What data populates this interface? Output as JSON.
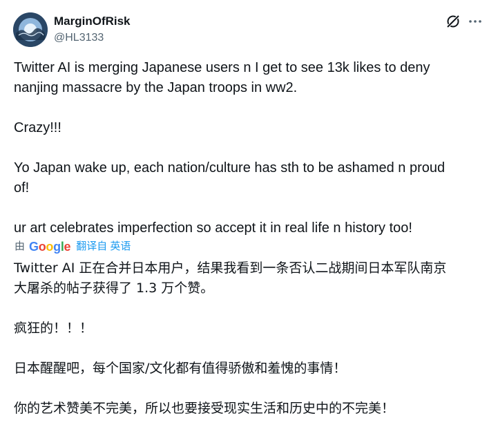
{
  "author": {
    "display_name": "MarginOfRisk",
    "handle": "@HL3133"
  },
  "icons": {
    "grok": "grok-icon",
    "more": "more-icon",
    "avatar": "avatar"
  },
  "tweet": {
    "original_text": "Twitter AI is merging Japanese users n I get to see 13k likes to deny\nnanjing massacre by the Japan troops in ww2.\n\nCrazy!!!\n\nYo Japan wake up, each nation/culture has sth to be ashamed n proud\nof!\n\nur art celebrates imperfection so accept it in real life n history too!",
    "translated_text": "Twitter AI 正在合并日本用户，结果我看到一条否认二战期间日本军队南京\n大屠杀的帖子获得了 1.3 万个赞。\n\n疯狂的！！！\n\n日本醒醒吧，每个国家/文化都有值得骄傲和羞愧的事情！\n\n你的艺术赞美不完美，所以也要接受现实生活和历史中的不完美！"
  },
  "translation": {
    "prefix": "由",
    "provider_letters": [
      "G",
      "o",
      "o",
      "g",
      "l",
      "e"
    ],
    "link_label": "翻译自 英语"
  },
  "colors": {
    "text": "#0f1419",
    "secondary": "#536471",
    "link": "#1d9bf0",
    "google_blue": "#4285F4",
    "google_red": "#EA4335",
    "google_yellow": "#FBBC05",
    "google_green": "#34A853"
  }
}
